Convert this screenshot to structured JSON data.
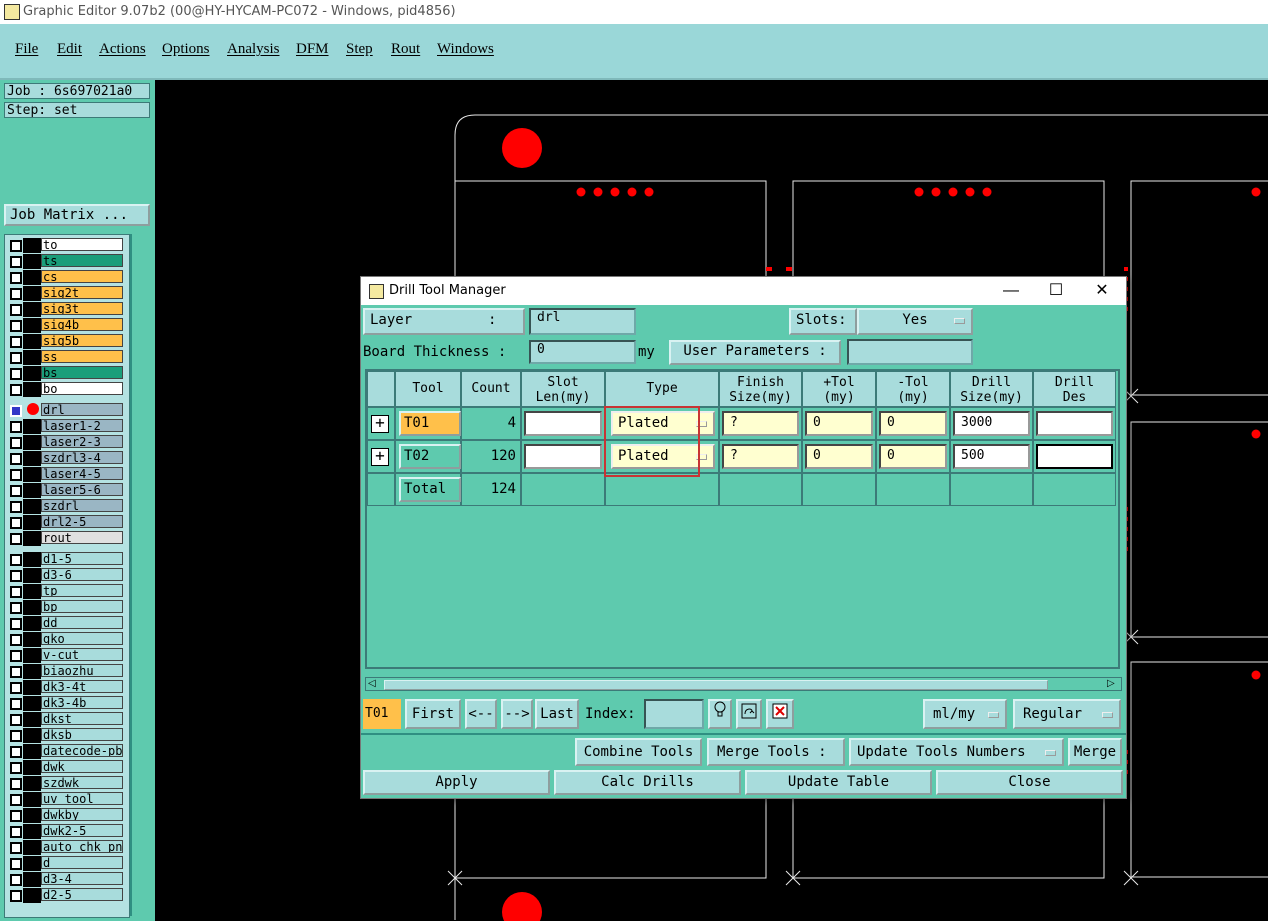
{
  "app": {
    "title": "Graphic Editor 9.07b2 (00@HY-HYCAM-PC072 - Windows, pid4856)"
  },
  "menu": [
    "File",
    "Edit",
    "Actions",
    "Options",
    "Analysis",
    "DFM",
    "Step",
    "Rout",
    "Windows"
  ],
  "job": {
    "job_label": "Job : 6s697021a0",
    "step_label": "Step: set",
    "matrix_button": "Job Matrix ..."
  },
  "layers_top": [
    {
      "name": "to",
      "color": "#ffffff"
    },
    {
      "name": "ts",
      "color": "#1a9e7a"
    },
    {
      "name": "cs",
      "color": "#ffc04a"
    },
    {
      "name": "sig2t",
      "color": "#ffc04a"
    },
    {
      "name": "sig3t",
      "color": "#ffc04a"
    },
    {
      "name": "sig4b",
      "color": "#ffc04a"
    },
    {
      "name": "sig5b",
      "color": "#ffc04a"
    },
    {
      "name": "ss",
      "color": "#ffc04a"
    },
    {
      "name": "bs",
      "color": "#1a9e7a"
    },
    {
      "name": "bo",
      "color": "#ffffff"
    }
  ],
  "layers_drill": [
    {
      "name": "drl",
      "color": "#9ab6c4"
    },
    {
      "name": "laser1-2",
      "color": "#9ab6c4"
    },
    {
      "name": "laser2-3",
      "color": "#9ab6c4"
    },
    {
      "name": "szdrl3-4",
      "color": "#9ab6c4"
    },
    {
      "name": "laser4-5",
      "color": "#9ab6c4"
    },
    {
      "name": "laser5-6",
      "color": "#9ab6c4"
    },
    {
      "name": "szdrl",
      "color": "#9ab6c4"
    },
    {
      "name": "drl2-5",
      "color": "#9ab6c4"
    },
    {
      "name": "rout",
      "color": "#e0e0e0"
    }
  ],
  "layers_misc": [
    {
      "name": "d1-5"
    },
    {
      "name": "d3-6"
    },
    {
      "name": "tp"
    },
    {
      "name": "bp"
    },
    {
      "name": "dd"
    },
    {
      "name": "gko"
    },
    {
      "name": "v-cut"
    },
    {
      "name": "biaozhu"
    },
    {
      "name": "dk3-4t"
    },
    {
      "name": "dk3-4b"
    },
    {
      "name": "dkst"
    },
    {
      "name": "dksb"
    },
    {
      "name": "datecode-pbo"
    },
    {
      "name": "dwk"
    },
    {
      "name": "szdwk"
    },
    {
      "name": "uv_tool"
    },
    {
      "name": "dwkby"
    },
    {
      "name": "dwk2-5"
    },
    {
      "name": "auto_chk_pn"
    },
    {
      "name": "d"
    },
    {
      "name": "d3-4"
    },
    {
      "name": "d2-5"
    }
  ],
  "dialog": {
    "title": "Drill Tool Manager",
    "minimize": "—",
    "maximize": "☐",
    "close": "✕",
    "layer_label": "Layer         :",
    "layer_value": "drl",
    "slots_label": "Slots:",
    "slots_value": "Yes",
    "thickness_label": "Board Thickness :",
    "thickness_value": "0",
    "thickness_unit": "my",
    "user_params_button": "User Parameters :",
    "user_params_value": "",
    "columns": [
      {
        "key": "tool",
        "label": "Tool"
      },
      {
        "key": "count",
        "label": "Count"
      },
      {
        "key": "slot",
        "label": "Slot\nLen(my)"
      },
      {
        "key": "type",
        "label": "Type"
      },
      {
        "key": "finish",
        "label": "Finish\nSize(my)"
      },
      {
        "key": "ptol",
        "label": "+Tol\n(my)"
      },
      {
        "key": "mtol",
        "label": "-Tol\n(my)"
      },
      {
        "key": "drill",
        "label": "Drill\nSize(my)"
      },
      {
        "key": "des",
        "label": "Drill\nDes"
      }
    ],
    "rows": [
      {
        "tool": "T01",
        "count": "4",
        "slot": "",
        "type": "Plated",
        "finish": "?",
        "ptol": "0",
        "mtol": "0",
        "drill": "3000",
        "des": "",
        "expand": "+"
      },
      {
        "tool": "T02",
        "count": "120",
        "slot": "",
        "type": "Plated",
        "finish": "?",
        "ptol": "0",
        "mtol": "0",
        "drill": "500",
        "des": "",
        "expand": "+"
      }
    ],
    "total_label": "Total",
    "total_count": "124",
    "current_tool": "T01",
    "nav": {
      "first": "First",
      "prev": "<--",
      "next": "-->",
      "last": "Last",
      "index_label": "Index:",
      "index_value": ""
    },
    "units_value": "ml/my",
    "mode_value": "Regular",
    "combine_button": "Combine Tools",
    "merge_label": "Merge Tools :",
    "update_numbers_value": "Update Tools Numbers",
    "merge_button": "Merge",
    "apply_button": "Apply",
    "calc_button": "Calc Drills",
    "update_table_button": "Update Table",
    "close_button": "Close"
  },
  "colors": {
    "teal": "#5ecaae",
    "light_teal": "#a8dcdc",
    "highlight_orange": "#ffc04a",
    "pad_red": "#ff0000"
  }
}
